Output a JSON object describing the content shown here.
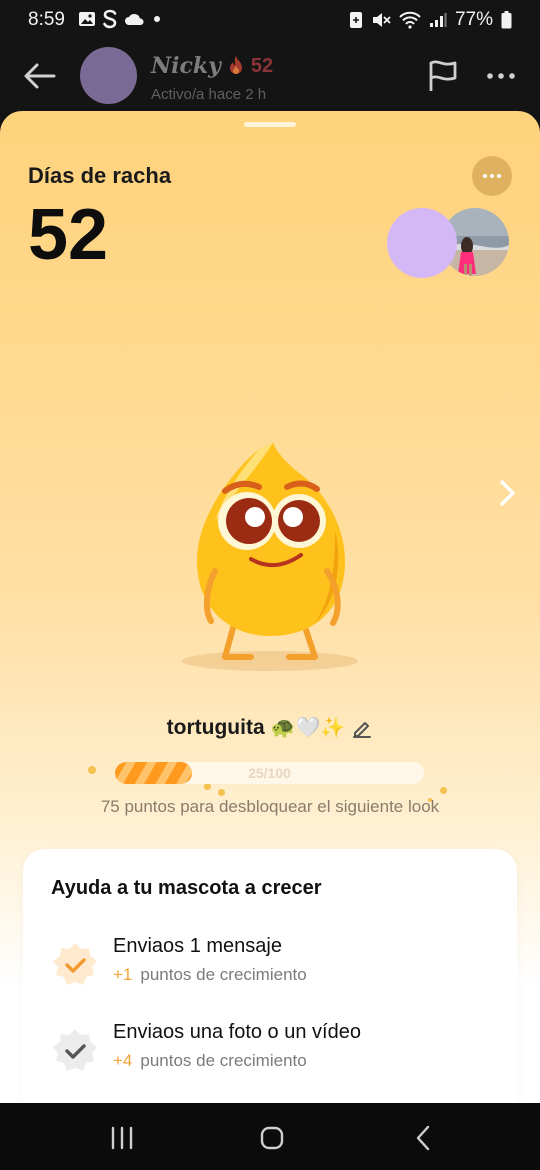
{
  "status_bar": {
    "time": "8:59",
    "battery": "77%"
  },
  "chat_header": {
    "name": "Nicky",
    "streak": "52",
    "active_status": "Activo/a hace 2 h"
  },
  "streak_sheet": {
    "label": "Días de racha",
    "value": "52"
  },
  "pet": {
    "name": "tortuguita",
    "emoji": "🐢🤍✨",
    "progress_current": 25,
    "progress_max": 100,
    "progress_text": "25/100",
    "progress_caption": "75 puntos para desbloquear el siguiente look"
  },
  "tasks_card": {
    "title": "Ayuda a tu mascota a crecer",
    "tasks": [
      {
        "title": "Enviaos 1 mensaje",
        "points": "+1",
        "subtitle": "puntos de crecimiento",
        "completed": true
      },
      {
        "title": "Enviaos una foto o un vídeo",
        "points": "+4",
        "subtitle": "puntos de crecimiento",
        "completed": false
      }
    ]
  },
  "colors": {
    "sheet_top": "#ffd27c",
    "accent_orange": "#ff9a1f",
    "points_orange": "#f2a338",
    "streak_red": "#8b3436"
  }
}
